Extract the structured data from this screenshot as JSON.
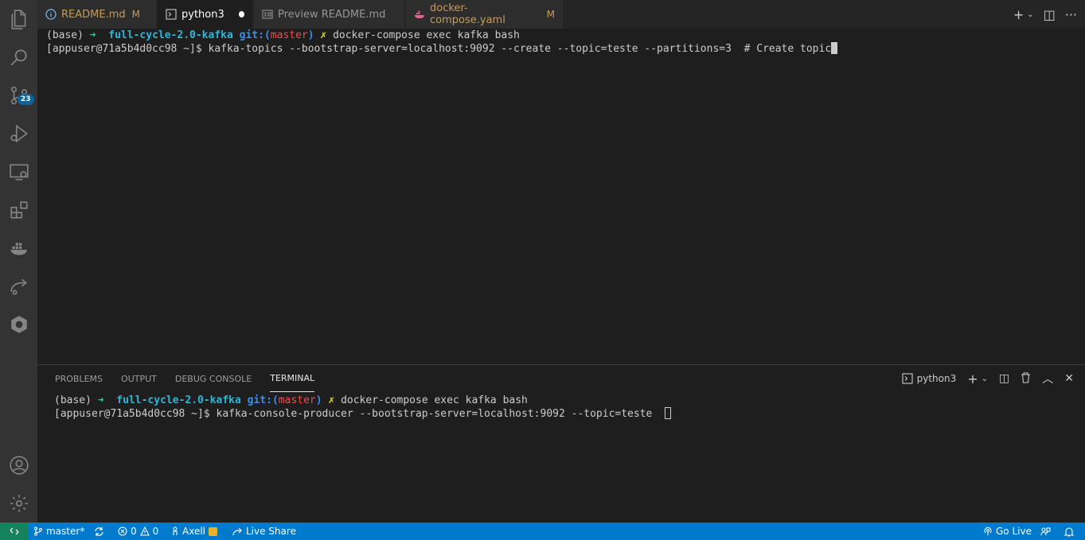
{
  "activity_bar": {
    "scm_badge": "23"
  },
  "tabs": [
    {
      "label": "README.md",
      "modified": "M"
    },
    {
      "label": "python3"
    },
    {
      "label": "Preview README.md"
    },
    {
      "label": "docker-compose.yaml",
      "modified": "M"
    }
  ],
  "editor_terminal": {
    "line1": {
      "prompt_base": "(base) ",
      "arrow": "➜",
      "dir": "full-cycle-2.0-kafka",
      "git_label": "git:(",
      "branch": "master",
      "git_close": ")",
      "dirty": "✗",
      "command": "docker-compose exec kafka bash"
    },
    "line2": {
      "prompt": "[appuser@71a5b4d0cc98 ~]$ ",
      "command": "kafka-topics --bootstrap-server=localhost:9092 --create --topic=teste --partitions=3  # Create topic"
    }
  },
  "panel": {
    "tabs": [
      "PROBLEMS",
      "OUTPUT",
      "DEBUG CONSOLE",
      "TERMINAL"
    ],
    "active_tab": "TERMINAL",
    "terminal_name": "python3",
    "line1": {
      "prompt_base": "(base) ",
      "arrow": "➜",
      "dir": "full-cycle-2.0-kafka",
      "git_label": "git:(",
      "branch": "master",
      "git_close": ")",
      "dirty": "✗",
      "command": "docker-compose exec kafka bash"
    },
    "line2": {
      "prompt": "[appuser@71a5b4d0cc98 ~]$ ",
      "command": "kafka-console-producer --bootstrap-server=localhost:9092 --topic=teste "
    }
  },
  "status_bar": {
    "branch": "master*",
    "errors": "0",
    "warnings": "0",
    "account": "Axell",
    "live_share": "Live Share",
    "go_live": "Go Live"
  },
  "colors": {
    "status_bar": "#007acc",
    "remote": "#16825d",
    "activity_bar": "#333333",
    "editor_bg": "#1e1e1e"
  }
}
